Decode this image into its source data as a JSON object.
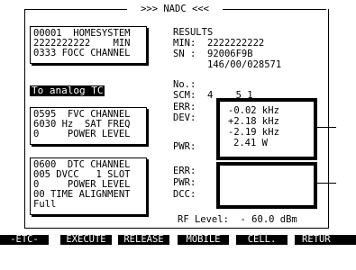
{
  "header": {
    "title": ">>> NADC <<<"
  },
  "system_box": {
    "rows": [
      "00001  HOMESYSTEM",
      "2222222222    MIN",
      "0333 FOCC CHANNEL"
    ]
  },
  "status": {
    "label": "To analog TC"
  },
  "fvc_box": {
    "rows": [
      "0595  FVC CHANNEL",
      "6030 Hz  SAT FREQ",
      "0     POWER LEVEL"
    ]
  },
  "dtc_box": {
    "rows": [
      "0600  DTC CHANNEL",
      "005 DVCC   1 SLOT",
      "0     POWER LEVEL",
      "00 TIME ALIGNMENT",
      "Full"
    ]
  },
  "results": {
    "heading": "RESULTS",
    "min_label": "MIN:",
    "min_value": "2222222222",
    "sn_label": "SN :",
    "sn_value": "92006F9B",
    "sn_value2": "146/00/028571",
    "no_label": "No.:",
    "scm_label": "SCM:",
    "scm_value": "4    5 1"
  },
  "measure1": {
    "err_label": "ERR:",
    "dev_label": "DEV:",
    "pwr_label": "PWR:",
    "err_value": "-0.02 kHz",
    "dev_value_1": "+2.18 kHz",
    "dev_value_2": "-2.19 kHz",
    "pwr_value": "2.41 W"
  },
  "measure2": {
    "err_label": "ERR:",
    "pwr_label": "PWR:",
    "dcc_label": "DCC:"
  },
  "rf_level": {
    "text": "RF Level:  - 60.0 dBm"
  },
  "softkeys": [
    "-ETC-",
    "EXECUTE",
    "RELEASE",
    "MOBILE",
    "CELL.",
    "RETUR"
  ]
}
